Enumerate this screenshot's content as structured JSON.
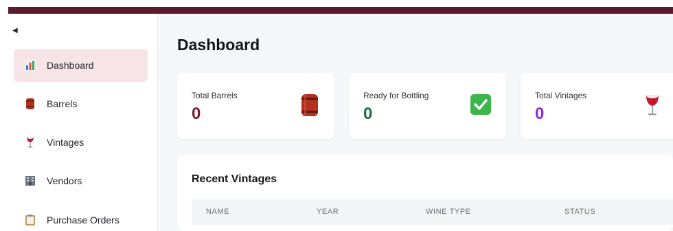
{
  "sidebar": {
    "collapse_icon": "caret-left-icon",
    "items": [
      {
        "label": "Dashboard",
        "icon": "bar-chart-icon",
        "active": true
      },
      {
        "label": "Barrels",
        "icon": "barrel-icon"
      },
      {
        "label": "Vintages",
        "icon": "wine-glass-icon"
      },
      {
        "label": "Vendors",
        "icon": "building-icon"
      },
      {
        "label": "Purchase Orders",
        "icon": "clipboard-icon"
      }
    ]
  },
  "main": {
    "title": "Dashboard",
    "stats": [
      {
        "label": "Total Barrels",
        "value": "0",
        "color": "#7a1c2e",
        "icon": "barrel-icon"
      },
      {
        "label": "Ready for Bottling",
        "value": "0",
        "color": "#1f6b3a",
        "icon": "check-box-icon"
      },
      {
        "label": "Total Vintages",
        "value": "0",
        "color": "#8a2be2",
        "icon": "wine-glass-icon"
      }
    ],
    "recent": {
      "title": "Recent Vintages",
      "columns": [
        "NAME",
        "YEAR",
        "WINE TYPE",
        "STATUS"
      ]
    }
  },
  "colors": {
    "brand": "#5a1a2c",
    "active_bg": "#f7e4e6"
  }
}
